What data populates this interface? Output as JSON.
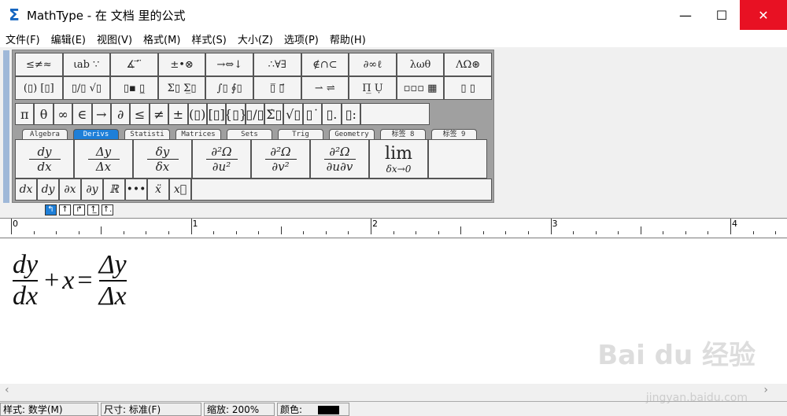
{
  "window": {
    "title": "MathType - 在 文档 里的公式",
    "icon": "sigma-icon",
    "minimize": "—",
    "maximize": "☐",
    "close": "✕"
  },
  "menu": [
    "文件(F)",
    "编辑(E)",
    "视图(V)",
    "格式(M)",
    "样式(S)",
    "大小(Z)",
    "选项(P)",
    "帮助(H)"
  ],
  "palette_row1": [
    "≤≠≈",
    "⍳ab ∵",
    "∡ ⃗ ̈",
    "±•⊗",
    "→⇔↓",
    "∴∀∃",
    "∉∩⊂",
    "∂∞ℓ",
    "λωθ",
    "ΛΩ⊛"
  ],
  "palette_row2": [
    "(▯) [▯]",
    "▯/▯ √▯",
    "▯▪ ▯̲",
    "Σ▯ Σ̲▯",
    "∫▯ ∮▯",
    "▯̅ ▯⃗",
    "⇀ ⇌",
    "Π̲ Ụ",
    "▫▫▫ ▦",
    "▯ ▯"
  ],
  "symbols_row": [
    "π",
    "θ",
    "∞",
    "∈",
    "→",
    "∂",
    "≤",
    "≠",
    "±",
    "(▯)",
    "[▯]",
    "{▯}",
    "▯/▯",
    "Σ̇▯",
    "√▯",
    "▯˙",
    "▯.",
    "▯:"
  ],
  "tabs": [
    {
      "label": "Algebra"
    },
    {
      "label": "Derivs",
      "active": true
    },
    {
      "label": "Statisti"
    },
    {
      "label": "Matrices"
    },
    {
      "label": "Sets"
    },
    {
      "label": "Trig"
    },
    {
      "label": "Geometry"
    },
    {
      "label": "标签 8"
    },
    {
      "label": "标签 9"
    }
  ],
  "templates": [
    {
      "num": "dy",
      "den": "dx"
    },
    {
      "num": "Δy",
      "den": "Δx"
    },
    {
      "num": "δy",
      "den": "δx"
    },
    {
      "num": "∂²Ω",
      "den": "∂u²"
    },
    {
      "num": "∂²Ω",
      "den": "∂v²"
    },
    {
      "num": "∂²Ω",
      "den": "∂u∂v"
    },
    {
      "num": "lim",
      "den": "δx→0"
    }
  ],
  "small_row": [
    "dx",
    "dy",
    "∂x",
    "∂y",
    "ℝ",
    "•••",
    "ẍ",
    "x⃛"
  ],
  "nudge": [
    "↰",
    "↑",
    "↱",
    "↑̲",
    "↑."
  ],
  "ruler": {
    "labels": [
      "0",
      "1",
      "2",
      "3",
      "4"
    ]
  },
  "equation": {
    "lhs_num": "dy",
    "lhs_den": "dx",
    "plus": "+",
    "x": "x",
    "eq": "=",
    "rhs_num": "Δy",
    "rhs_den": "Δx"
  },
  "watermark": {
    "main": "Bai du 经验",
    "url": "jingyan.baidu.com"
  },
  "status": {
    "style": "样式: 数学(M)",
    "size": "尺寸: 标准(F)",
    "zoom": "缩放: 200%",
    "color_label": "颜色:",
    "color": "#000000"
  },
  "scroll": {
    "left": "‹",
    "right": "›"
  },
  "colors": {
    "accent": "#1e7fd8",
    "close": "#e81123"
  }
}
